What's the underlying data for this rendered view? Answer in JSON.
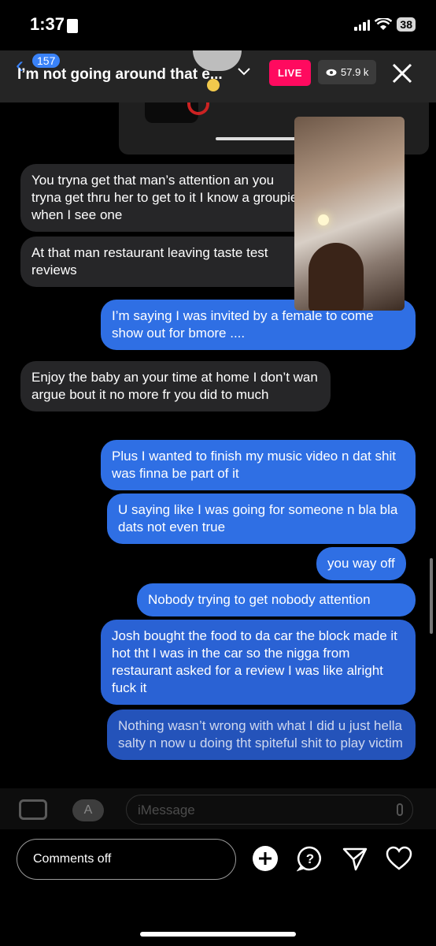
{
  "status": {
    "time": "1:37",
    "battery": "38"
  },
  "header": {
    "back_count": "157",
    "title": "I’m not going around that e...",
    "live_label": "LIVE",
    "viewers": "57.9 k"
  },
  "messages": [
    {
      "dir": "in",
      "text": "You tryna get that man’s attention an you tryna get thru her to get to it I know a groupie when I see one"
    },
    {
      "dir": "in",
      "text": "At that man restaurant leaving taste test reviews"
    },
    {
      "dir": "out",
      "text": "I’m saying I was invited by a female to come show out for bmore ...."
    },
    {
      "dir": "in",
      "text": "Enjoy the baby an your time at home I don’t wan argue bout it no more fr you did to much"
    },
    {
      "dir": "out",
      "text": "Plus I wanted to finish my music video n dat shit was finna be part of it"
    },
    {
      "dir": "out",
      "text": "U saying like I was going for someone n bla bla dats not even true"
    },
    {
      "dir": "out",
      "text": "you way off"
    },
    {
      "dir": "out",
      "text": "Nobody trying to get nobody attention"
    },
    {
      "dir": "out",
      "text": "Josh bought the food to da car the block made it hot tht I was in the car so the nigga from restaurant asked for a review I was like alright fuck it"
    },
    {
      "dir": "out",
      "text": "Nothing wasn’t wrong with what I did u just hella salty n now u doing tht spiteful shit to play victim"
    }
  ],
  "imessage": {
    "placeholder": "iMessage"
  },
  "footer": {
    "comments_label": "Comments off"
  },
  "icons": [
    "contact-card-icon",
    "signal-icon",
    "wifi-icon",
    "battery-icon",
    "chevron-left-icon",
    "chevron-down-icon",
    "eye-icon",
    "close-icon",
    "camera-icon",
    "appstore-icon",
    "mic-icon",
    "add-icon",
    "question-icon",
    "send-icon",
    "heart-icon"
  ],
  "colors": {
    "live": "#ff0a5f",
    "outgoing_bubble": "#2f6fe4",
    "incoming_bubble": "#262628",
    "ios_blue": "#3a82f7"
  }
}
